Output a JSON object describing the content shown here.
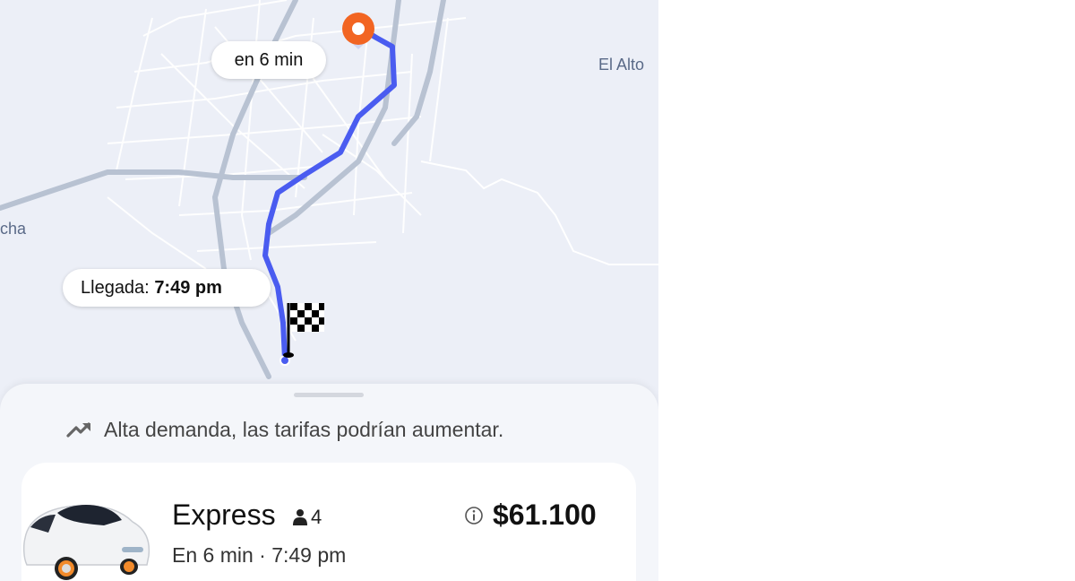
{
  "map": {
    "eta_label": "en 6 min",
    "arrival_prefix": "Llegada:",
    "arrival_time": "7:49 pm",
    "places": [
      "El Alto",
      "cha"
    ],
    "route_color": "#4a5cf0",
    "pickup_color": "#f26522",
    "icons": [
      "pickup-pin-icon",
      "destination-flag-icon"
    ]
  },
  "sheet": {
    "demand_notice": "Alta demanda, las tarifas podrían aumentar.",
    "demand_icon": "trending-up-icon",
    "ride": {
      "name": "Express",
      "seats": "4",
      "eta_text": "En 6 min · 7:49 pm",
      "price": "$61.100",
      "icon": "car-icon"
    }
  }
}
